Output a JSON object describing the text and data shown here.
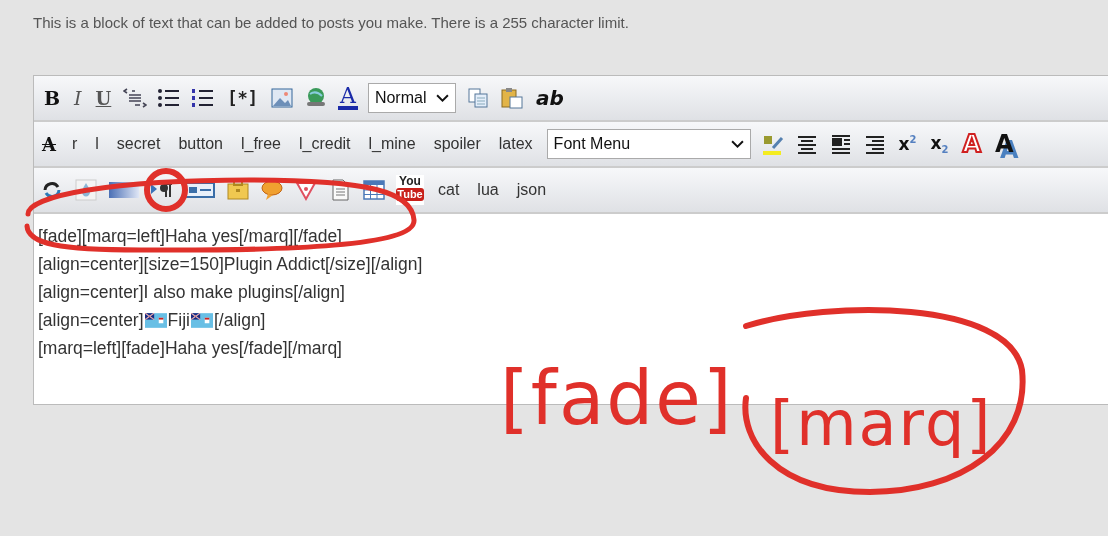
{
  "intro": "This is a block of text that can be added to posts you make. There is a 255 character limit.",
  "toolbar_row_1": {
    "bold": "B",
    "italic": "I",
    "underline": "U",
    "list_item": "[*]",
    "font_color": "A",
    "size_select": "Normal",
    "plain_text": "ab"
  },
  "toolbar_row_2": {
    "strike": "A",
    "tags": [
      "r",
      "l",
      "secret",
      "button",
      "l_free",
      "l_credit",
      "l_mine",
      "spoiler",
      "latex"
    ],
    "font_select": "Font Menu",
    "superscript": "x$^{2}$",
    "subscript": "x$_{2}$",
    "outline_a": "A",
    "shadow_a": "A"
  },
  "toolbar_row_3": {
    "video_logo": [
      "You",
      "Tube"
    ],
    "tags": [
      "cat",
      "lua",
      "json"
    ]
  },
  "editor_lines": [
    {
      "parts": [
        {
          "kind": "text",
          "text": "[fade][marq=left]Haha yes[/marq][/fade]"
        }
      ]
    },
    {
      "parts": [
        {
          "kind": "text",
          "text": "[align=center][size=150]Plugin Addict[/size][/align]"
        }
      ]
    },
    {
      "parts": [
        {
          "kind": "text",
          "text": "[align=center]I also make plugins[/align]"
        }
      ]
    },
    {
      "parts": [
        {
          "kind": "text",
          "text": "[align=center]"
        },
        {
          "kind": "flag"
        },
        {
          "kind": "text",
          "text": "Fiji"
        },
        {
          "kind": "flag"
        },
        {
          "kind": "text",
          "text": "[/align]"
        }
      ]
    },
    {
      "parts": [
        {
          "kind": "text",
          "text": "[marq=left][fade]Haha yes[/fade][/marq]"
        }
      ]
    }
  ],
  "annotation": {
    "texts": [
      "[fade]",
      "[marq]"
    ]
  }
}
